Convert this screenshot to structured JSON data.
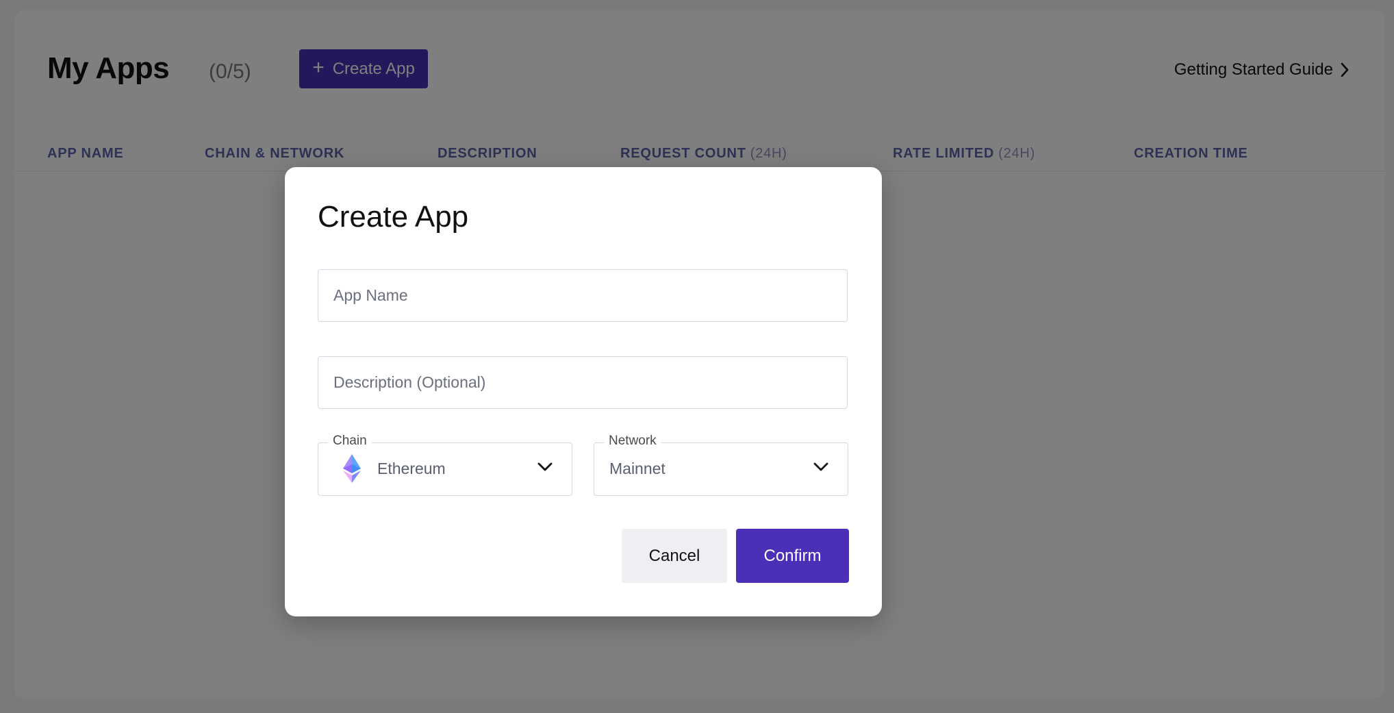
{
  "header": {
    "title": "My Apps",
    "count": "(0/5)",
    "create_button_label": "Create App",
    "guide_link_label": "Getting Started Guide"
  },
  "table": {
    "columns": [
      {
        "label": "APP NAME",
        "sub": ""
      },
      {
        "label": "CHAIN & NETWORK",
        "sub": ""
      },
      {
        "label": "DESCRIPTION",
        "sub": ""
      },
      {
        "label": "REQUEST COUNT",
        "sub": "(24H)"
      },
      {
        "label": "RATE LIMITED",
        "sub": "(24H)"
      },
      {
        "label": "CREATION TIME",
        "sub": ""
      }
    ]
  },
  "modal": {
    "title": "Create App",
    "app_name_placeholder": "App Name",
    "description_placeholder": "Description (Optional)",
    "chain": {
      "label": "Chain",
      "value": "Ethereum",
      "icon": "ethereum-icon"
    },
    "network": {
      "label": "Network",
      "value": "Mainnet"
    },
    "cancel_label": "Cancel",
    "confirm_label": "Confirm"
  },
  "colors": {
    "accent": "#4b2fb7",
    "table_header": "#5b64a8"
  }
}
